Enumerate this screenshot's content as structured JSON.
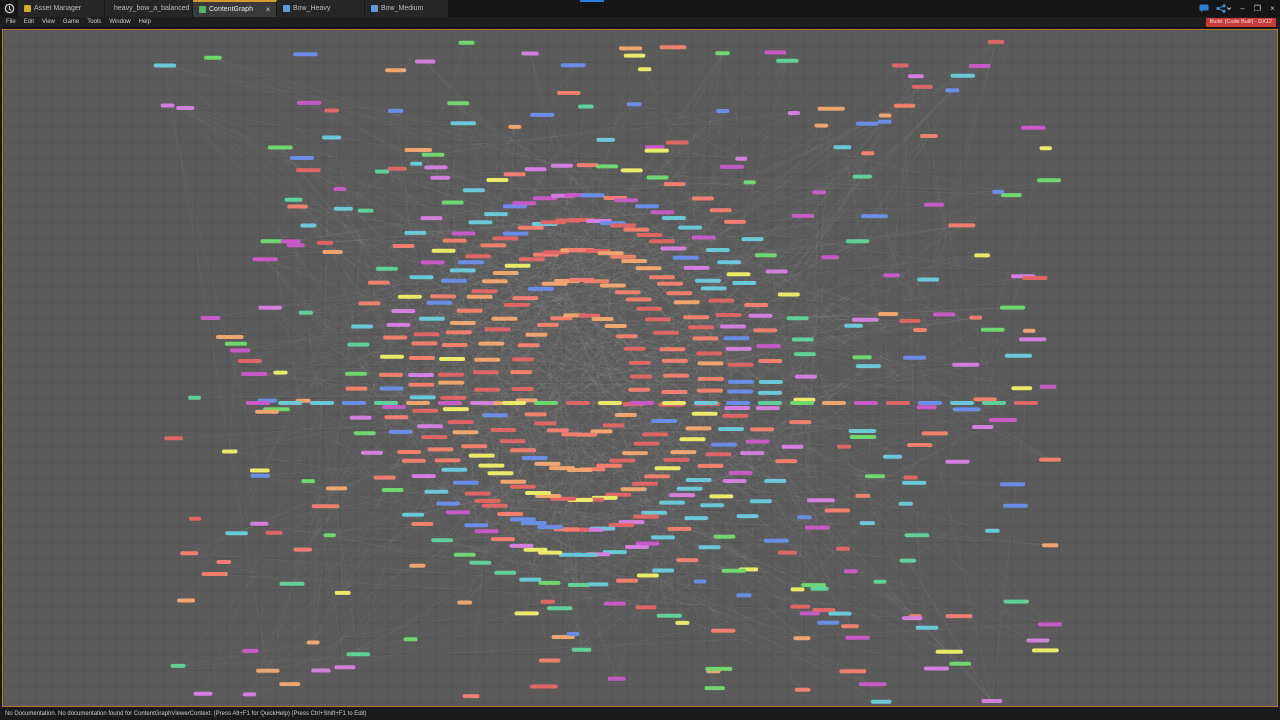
{
  "tabs": [
    {
      "label": "Asset Manager",
      "icon": "folder-icon",
      "color": "#d9a72a",
      "active": false
    },
    {
      "label": "heavy_bow_a_balanced",
      "icon": "document-icon",
      "color": "#5b9be0",
      "active": false
    },
    {
      "label": "ContentGraph",
      "icon": "graph-icon",
      "color": "#4fb36a",
      "active": true
    },
    {
      "label": "Bow_Heavy",
      "icon": "document-icon",
      "color": "#5b9be0",
      "active": false
    },
    {
      "label": "Bow_Medium",
      "icon": "document-icon",
      "color": "#5b9be0",
      "active": false
    }
  ],
  "menu": [
    "File",
    "Edit",
    "View",
    "Game",
    "Tools",
    "Window",
    "Help"
  ],
  "build_badge": "Build: [Code Built] - DX12",
  "status_text": "No Documentation. No documentation found for ContentGraphViewerContext. (Press Alt+F1 for QuickHelp) (Press Ctrl+Shift+F1 to Edit)",
  "colors": {
    "accent": "#d59a2b",
    "viewport_bg": "#5b5b5b",
    "node_palette": [
      "#f07f6e",
      "#e06565",
      "#c85ac8",
      "#d47fe0",
      "#eaea6a",
      "#6ac8d8",
      "#5fd09a",
      "#6a8ee8",
      "#f0a46e",
      "#6ed86e"
    ]
  }
}
